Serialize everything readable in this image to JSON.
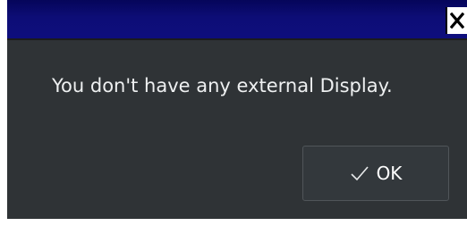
{
  "dialog": {
    "message": "You don't have any external Display.",
    "ok_label": "OK",
    "close_glyph": "X"
  },
  "icons": {
    "close": "close-icon",
    "ok": "checkmark-icon"
  },
  "colors": {
    "titlebar": "#0e0e7d",
    "dialog_bg": "#2f3336",
    "text": "#eef0f1",
    "button_border": "#505559"
  }
}
